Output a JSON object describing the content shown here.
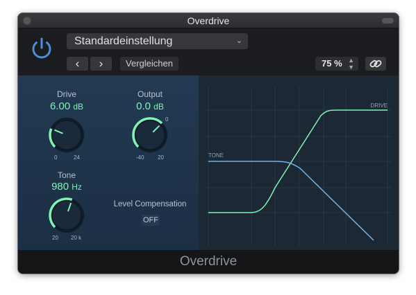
{
  "window": {
    "title": "Overdrive"
  },
  "header": {
    "preset": "Standardeinstellung",
    "prev_label": "‹",
    "next_label": "›",
    "compare_label": "Vergleichen",
    "mix_value": "75 %"
  },
  "controls": {
    "drive": {
      "label": "Drive",
      "value": "6.00",
      "unit": "dB",
      "min": "0",
      "max": "24",
      "level": 0.25
    },
    "output": {
      "label": "Output",
      "value": "0.0",
      "unit": "dB",
      "min": "-40",
      "max": "20",
      "zero_mark": "0",
      "level": 0.667
    },
    "tone": {
      "label": "Tone",
      "value": "980",
      "unit": "Hz",
      "min": "20",
      "max": "20 k",
      "level": 0.57
    },
    "level_compensation": {
      "label": "Level Compensation",
      "state": "OFF"
    }
  },
  "graph": {
    "tone_label": "TONE",
    "drive_label": "DRIVE"
  },
  "footer": {
    "title": "Overdrive"
  },
  "colors": {
    "accent_green": "#7df5b3",
    "tone_blue": "#6fb3e8",
    "power_blue": "#4a90d9"
  }
}
